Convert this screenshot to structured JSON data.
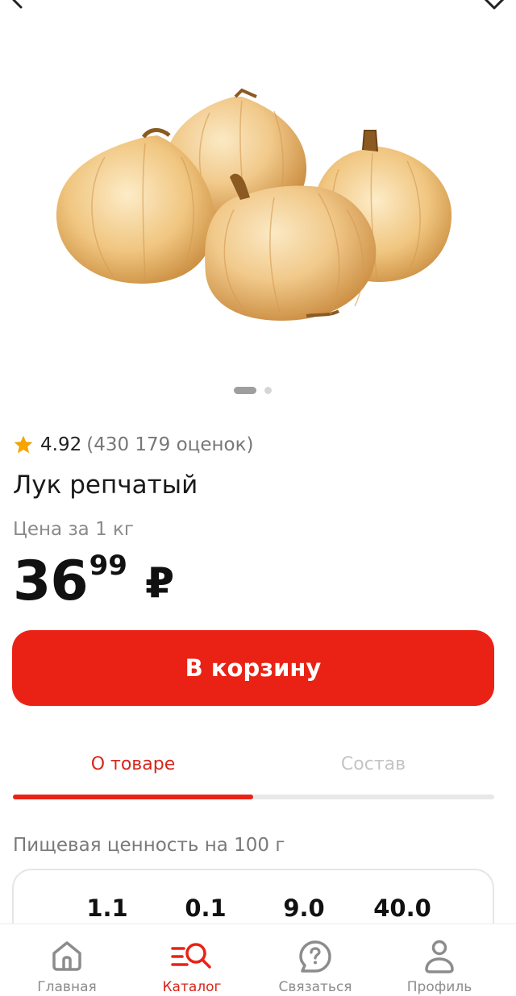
{
  "product": {
    "rating": "4.92",
    "rating_count": "(430 179 оценок)",
    "title": "Лук репчатый",
    "unit_label": "Цена за 1 кг",
    "price_int": "36",
    "price_frac": "99",
    "currency": "₽"
  },
  "gallery": {
    "current_image": 1,
    "total_images": 2
  },
  "cart_button": {
    "label": "В корзину"
  },
  "tabs": [
    {
      "label": "О товаре",
      "active": true
    },
    {
      "label": "Состав",
      "active": false
    }
  ],
  "nutrition": {
    "title": "Пищевая ценность на 100 г",
    "values": [
      "1.1",
      "0.1",
      "9.0",
      "40.0"
    ]
  },
  "bottom_nav": [
    {
      "label": "Главная",
      "icon": "home-icon",
      "active": false
    },
    {
      "label": "Каталог",
      "icon": "catalog-search-icon",
      "active": true
    },
    {
      "label": "Связаться",
      "icon": "chat-help-icon",
      "active": false
    },
    {
      "label": "Профиль",
      "icon": "profile-icon",
      "active": false
    }
  ],
  "colors": {
    "accent": "#ea2216",
    "star": "#f6a400",
    "muted": "#8a8a8a"
  }
}
